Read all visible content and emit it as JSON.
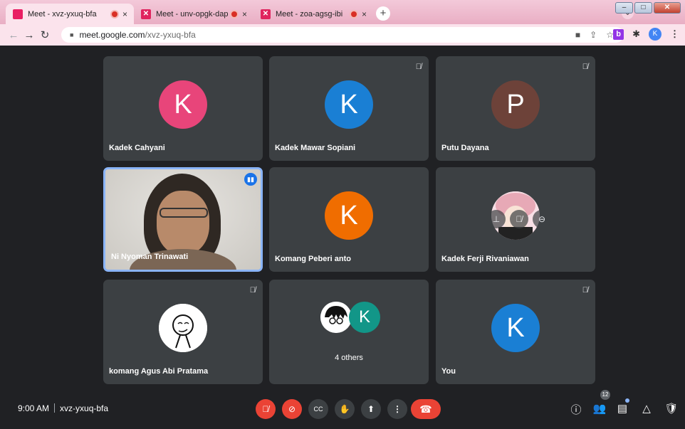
{
  "browser": {
    "tabs": [
      {
        "title": "Meet - xvz-yxuq-bfa",
        "close": "×"
      },
      {
        "title": "Meet - unv-opgk-dap",
        "close": "×"
      },
      {
        "title": "Meet - zoa-agsg-ibi",
        "close": "×"
      }
    ],
    "new_tab": "+",
    "address": {
      "host": "meet.google.com",
      "path": "/xvz-yxuq-bfa"
    },
    "profile_initial": "K",
    "extension_letter": "b"
  },
  "participants": [
    {
      "name": "Kadek Cahyani",
      "initial": "K",
      "color": "#e8457a",
      "muted": false
    },
    {
      "name": "Kadek Mawar Sopiani",
      "initial": "K",
      "color": "#1a7fd4",
      "muted": true
    },
    {
      "name": "Putu Dayana",
      "initial": "P",
      "color": "#6d4239",
      "muted": true
    },
    {
      "name": "Ni Nyoman Trinawati",
      "video": true,
      "speaking": true
    },
    {
      "name": "Komang Peberi anto",
      "initial": "K",
      "color": "#f06d00",
      "muted": false
    },
    {
      "name": "Kadek Ferji Rivaniawan",
      "photo": true
    },
    {
      "name": "komang Agus Abi Pratama",
      "photo": true,
      "muted": true
    },
    {
      "others_label": "4 others",
      "initial": "K",
      "color": "#129688"
    },
    {
      "name": "You",
      "initial": "K",
      "color": "#1a7fd4",
      "muted": true
    }
  ],
  "meeting": {
    "time": "9:00 AM",
    "code": "xvz-yxuq-bfa"
  },
  "people_count": "12"
}
